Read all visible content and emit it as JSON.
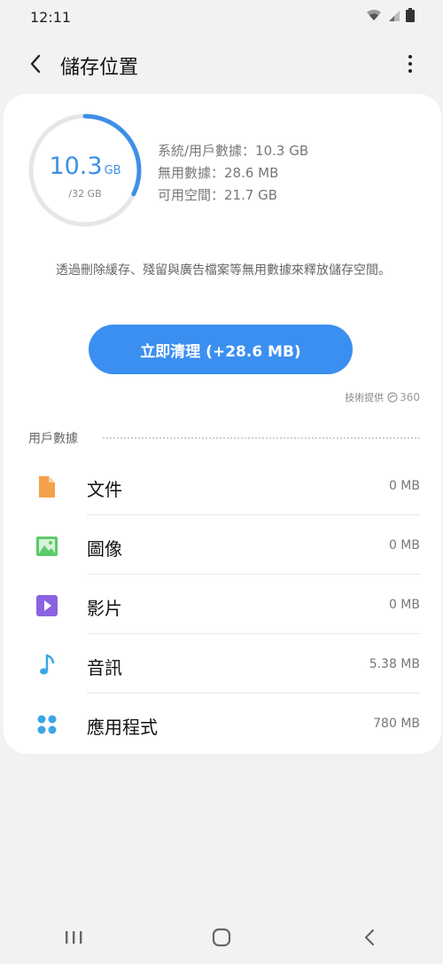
{
  "status_bar": {
    "time": "12:11"
  },
  "header": {
    "title": "儲存位置"
  },
  "storage": {
    "used_value": "10.3",
    "used_unit": "GB",
    "total": "/32 GB",
    "used_fraction": 0.322,
    "stats": [
      {
        "text": "系統/用戶數據：10.3 GB"
      },
      {
        "text": "無用數據：28.6 MB"
      },
      {
        "text": "可用空間：21.7 GB"
      }
    ]
  },
  "description": "透過刪除緩存、殘留與廣告檔案等無用數據來釋放儲存空間。",
  "clean_button": {
    "label": "立即清理 (+28.6 MB)"
  },
  "provider": {
    "label": "技術提供",
    "brand": "360"
  },
  "user_data": {
    "title": "用戶數據",
    "items": [
      {
        "label": "文件",
        "size": "0 MB",
        "icon": "document-icon"
      },
      {
        "label": "圖像",
        "size": "0 MB",
        "icon": "image-icon"
      },
      {
        "label": "影片",
        "size": "0 MB",
        "icon": "video-icon"
      },
      {
        "label": "音訊",
        "size": "5.38 MB",
        "icon": "music-note-icon"
      },
      {
        "label": "應用程式",
        "size": "780 MB",
        "icon": "apps-icon"
      }
    ]
  },
  "colors": {
    "accent": "#3b8ff0",
    "ring_track": "#e6e6e6",
    "ring_fill": "#3e8fe6",
    "doc_icon": "#f5a14a",
    "image_icon": "#5ccb6a",
    "video_icon": "#8b63e0",
    "audio_icon": "#3aa6e8",
    "apps_icon": "#3aa6e8"
  }
}
